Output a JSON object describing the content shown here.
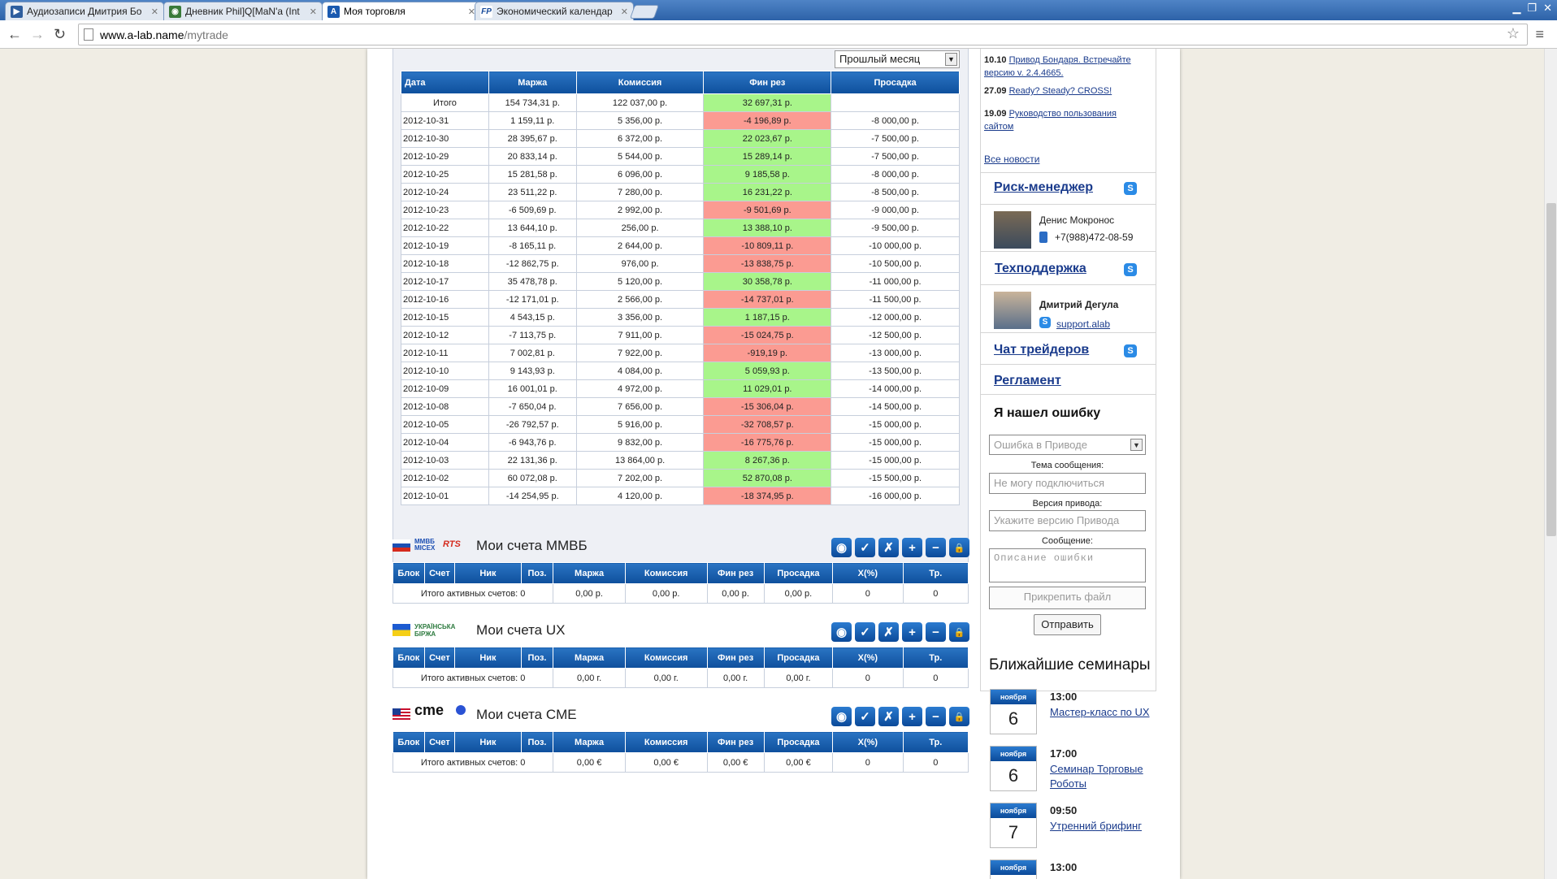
{
  "browser": {
    "tabs": [
      {
        "title": "Аудиозаписи Дмитрия Бо",
        "favicon": "play-icon"
      },
      {
        "title": "Дневник Phil]Q[MaN'a (Int",
        "favicon": "globe-icon"
      },
      {
        "title": "Моя торговля",
        "favicon": "a-lab-icon"
      },
      {
        "title": "Экономический календар",
        "favicon": "fp-icon"
      }
    ],
    "url_host": "www.a-lab.name",
    "url_path": "/mytrade"
  },
  "stats": {
    "period": "Прошлый месяц",
    "headers": [
      "Дата",
      "Маржа",
      "Комиссия",
      "Фин рез",
      "Просадка"
    ],
    "rows": [
      {
        "date": "Итого",
        "margin": "154 734,31 р.",
        "commission": "122 037,00 р.",
        "result": "32 697,31 р.",
        "drawdown": "",
        "sign": "pos"
      },
      {
        "date": "2012-10-31",
        "margin": "1 159,11 р.",
        "commission": "5 356,00 р.",
        "result": "-4 196,89 р.",
        "drawdown": "-8 000,00 р.",
        "sign": "neg"
      },
      {
        "date": "2012-10-30",
        "margin": "28 395,67 р.",
        "commission": "6 372,00 р.",
        "result": "22 023,67 р.",
        "drawdown": "-7 500,00 р.",
        "sign": "pos"
      },
      {
        "date": "2012-10-29",
        "margin": "20 833,14 р.",
        "commission": "5 544,00 р.",
        "result": "15 289,14 р.",
        "drawdown": "-7 500,00 р.",
        "sign": "pos"
      },
      {
        "date": "2012-10-25",
        "margin": "15 281,58 р.",
        "commission": "6 096,00 р.",
        "result": "9 185,58 р.",
        "drawdown": "-8 000,00 р.",
        "sign": "pos"
      },
      {
        "date": "2012-10-24",
        "margin": "23 511,22 р.",
        "commission": "7 280,00 р.",
        "result": "16 231,22 р.",
        "drawdown": "-8 500,00 р.",
        "sign": "pos"
      },
      {
        "date": "2012-10-23",
        "margin": "-6 509,69 р.",
        "commission": "2 992,00 р.",
        "result": "-9 501,69 р.",
        "drawdown": "-9 000,00 р.",
        "sign": "neg"
      },
      {
        "date": "2012-10-22",
        "margin": "13 644,10 р.",
        "commission": "256,00 р.",
        "result": "13 388,10 р.",
        "drawdown": "-9 500,00 р.",
        "sign": "pos"
      },
      {
        "date": "2012-10-19",
        "margin": "-8 165,11 р.",
        "commission": "2 644,00 р.",
        "result": "-10 809,11 р.",
        "drawdown": "-10 000,00 р.",
        "sign": "neg"
      },
      {
        "date": "2012-10-18",
        "margin": "-12 862,75 р.",
        "commission": "976,00 р.",
        "result": "-13 838,75 р.",
        "drawdown": "-10 500,00 р.",
        "sign": "neg"
      },
      {
        "date": "2012-10-17",
        "margin": "35 478,78 р.",
        "commission": "5 120,00 р.",
        "result": "30 358,78 р.",
        "drawdown": "-11 000,00 р.",
        "sign": "pos"
      },
      {
        "date": "2012-10-16",
        "margin": "-12 171,01 р.",
        "commission": "2 566,00 р.",
        "result": "-14 737,01 р.",
        "drawdown": "-11 500,00 р.",
        "sign": "neg"
      },
      {
        "date": "2012-10-15",
        "margin": "4 543,15 р.",
        "commission": "3 356,00 р.",
        "result": "1 187,15 р.",
        "drawdown": "-12 000,00 р.",
        "sign": "pos"
      },
      {
        "date": "2012-10-12",
        "margin": "-7 113,75 р.",
        "commission": "7 911,00 р.",
        "result": "-15 024,75 р.",
        "drawdown": "-12 500,00 р.",
        "sign": "neg"
      },
      {
        "date": "2012-10-11",
        "margin": "7 002,81 р.",
        "commission": "7 922,00 р.",
        "result": "-919,19 р.",
        "drawdown": "-13 000,00 р.",
        "sign": "neg"
      },
      {
        "date": "2012-10-10",
        "margin": "9 143,93 р.",
        "commission": "4 084,00 р.",
        "result": "5 059,93 р.",
        "drawdown": "-13 500,00 р.",
        "sign": "pos"
      },
      {
        "date": "2012-10-09",
        "margin": "16 001,01 р.",
        "commission": "4 972,00 р.",
        "result": "11 029,01 р.",
        "drawdown": "-14 000,00 р.",
        "sign": "pos"
      },
      {
        "date": "2012-10-08",
        "margin": "-7 650,04 р.",
        "commission": "7 656,00 р.",
        "result": "-15 306,04 р.",
        "drawdown": "-14 500,00 р.",
        "sign": "neg"
      },
      {
        "date": "2012-10-05",
        "margin": "-26 792,57 р.",
        "commission": "5 916,00 р.",
        "result": "-32 708,57 р.",
        "drawdown": "-15 000,00 р.",
        "sign": "neg"
      },
      {
        "date": "2012-10-04",
        "margin": "-6 943,76 р.",
        "commission": "9 832,00 р.",
        "result": "-16 775,76 р.",
        "drawdown": "-15 000,00 р.",
        "sign": "neg"
      },
      {
        "date": "2012-10-03",
        "margin": "22 131,36 р.",
        "commission": "13 864,00 р.",
        "result": "8 267,36 р.",
        "drawdown": "-15 000,00 р.",
        "sign": "pos"
      },
      {
        "date": "2012-10-02",
        "margin": "60 072,08 р.",
        "commission": "7 202,00 р.",
        "result": "52 870,08 р.",
        "drawdown": "-15 500,00 р.",
        "sign": "pos"
      },
      {
        "date": "2012-10-01",
        "margin": "-14 254,95 р.",
        "commission": "4 120,00 р.",
        "result": "-18 374,95 р.",
        "drawdown": "-16 000,00 р.",
        "sign": "neg"
      }
    ]
  },
  "accounts": {
    "headers": [
      "Блок",
      "Счет",
      "Ник",
      "Поз.",
      "Маржа",
      "Комиссия",
      "Фин рез",
      "Просадка",
      "X(%)",
      "Тр."
    ],
    "buttons": [
      "◉",
      "✓",
      "✗",
      "+",
      "−",
      "🔒"
    ],
    "sections": [
      {
        "title": "Мои счета ММВБ",
        "logo1": "ММВБ МICEX",
        "logo2": "RTS",
        "total_label": "Итого активных счетов: 0",
        "margin": "0,00 р.",
        "commission": "0,00 р.",
        "result": "0,00 р.",
        "drawdown": "0,00 р.",
        "x": "0",
        "tr": "0"
      },
      {
        "title": "Мои счета UX",
        "logo1": "УКРАЇНСЬКА БІРЖА",
        "logo2": "",
        "total_label": "Итого активных счетов: 0",
        "margin": "0,00 г.",
        "commission": "0,00 г.",
        "result": "0,00 г.",
        "drawdown": "0,00 г.",
        "x": "0",
        "tr": "0"
      },
      {
        "title": "Мои счета CME",
        "logo1": "cme",
        "logo2": "",
        "total_label": "Итого активных счетов: 0",
        "margin": "0,00 €",
        "commission": "0,00 €",
        "result": "0,00 €",
        "drawdown": "0,00 €",
        "x": "0",
        "tr": "0"
      }
    ]
  },
  "sidebar": {
    "news": [
      {
        "date": "10.10",
        "text": "Привод Бондаря. Встречайте версию v. 2.4.4665."
      },
      {
        "date": "27.09",
        "text": "Ready? Steady? CROSS!"
      },
      {
        "date": "19.09",
        "text": "Руководство пользования сайтом"
      }
    ],
    "all_news": "Все новости",
    "risk_title": "Риск-менеджер",
    "risk_name": "Денис Мокронос",
    "risk_phone": "+7(988)472-08-59",
    "support_title": "Техподдержка",
    "support_name": "Дмитрий Дегула",
    "support_skype": "support.alab",
    "chat_title": "Чат трейдеров",
    "rules_title": "Регламент",
    "bug_title": "Я нашел ошибку",
    "bug_select": "Ошибка в Приводе",
    "subject_label": "Тема сообщения:",
    "subject_placeholder": "Не могу подключиться",
    "version_label": "Версия привода:",
    "version_placeholder": "Укажите версию Привода",
    "message_label": "Сообщение:",
    "message_placeholder": "Описание ошибки",
    "attach_label": "Прикрепить файл",
    "send_label": "Отправить",
    "seminars_title": "Ближайшие семинары",
    "seminars": [
      {
        "month": "ноября",
        "day": "6",
        "time": "13:00",
        "title": "Мастер-класс по UX"
      },
      {
        "month": "ноября",
        "day": "6",
        "time": "17:00",
        "title": "Семинар Торговые Роботы"
      },
      {
        "month": "ноября",
        "day": "7",
        "time": "09:50",
        "title": "Утренний брифинг"
      },
      {
        "month": "ноября",
        "day": "",
        "time": "13:00",
        "title": ""
      }
    ]
  }
}
